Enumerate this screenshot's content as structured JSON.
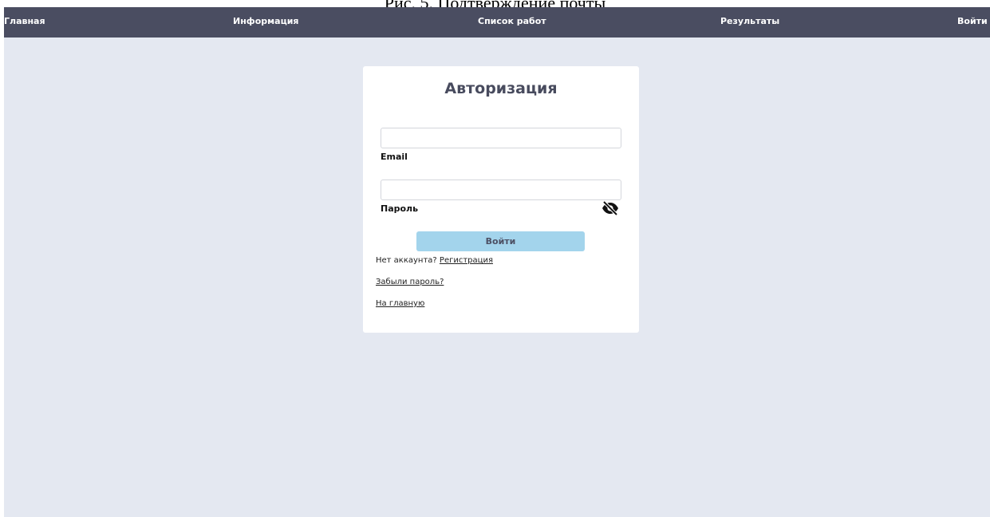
{
  "document": {
    "caption": "Рис. 5. Подтверждение почты"
  },
  "nav": {
    "home": "Главная",
    "info": "Информация",
    "works": "Список работ",
    "results": "Результаты",
    "login": "Войти"
  },
  "auth_form": {
    "title": "Авторизация",
    "email_value": "",
    "email_label": "Email",
    "password_value": "",
    "password_label": "Пароль",
    "password_toggle_icon": "eye-slash-icon",
    "submit_label": "Войти",
    "no_account_text": "Нет аккаунта?",
    "register_link": "Регистрация",
    "forgot_link": "Забыли пароль?",
    "home_link": "На главную"
  },
  "colors": {
    "navbar_bg": "#4a4d61",
    "page_bg": "#e4e8f1",
    "button_bg": "#a3d4ec",
    "title_color": "#484b5e"
  }
}
